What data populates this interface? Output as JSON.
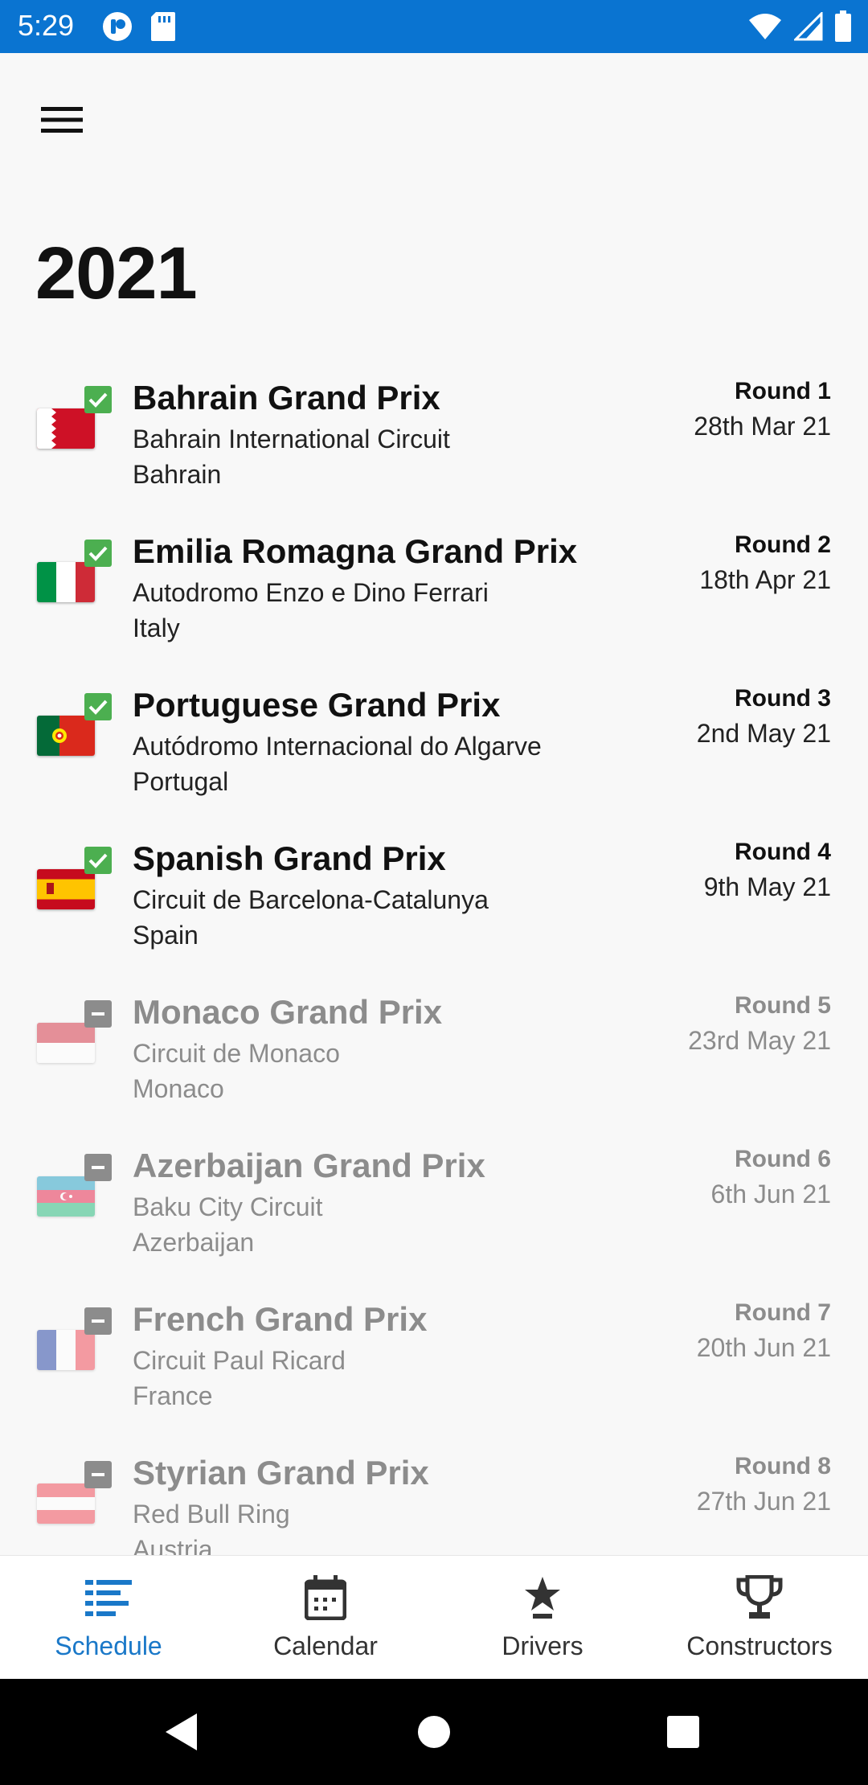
{
  "status_bar": {
    "time": "5:29",
    "icons": [
      "notification-app-icon",
      "sd-card-icon",
      "wifi-icon",
      "signal-icon",
      "battery-icon"
    ]
  },
  "header": {
    "menu_icon": "hamburger-menu-icon",
    "season": "2021"
  },
  "races": [
    {
      "name": "Bahrain Grand Prix",
      "circuit": "Bahrain International Circuit",
      "country": "Bahrain",
      "round": "Round 1",
      "date": "28th Mar 21",
      "status": "completed",
      "flag": "bahrain-flag"
    },
    {
      "name": "Emilia Romagna Grand Prix",
      "circuit": "Autodromo Enzo e Dino Ferrari",
      "country": "Italy",
      "round": "Round 2",
      "date": "18th Apr 21",
      "status": "completed",
      "flag": "italy-flag"
    },
    {
      "name": "Portuguese Grand Prix",
      "circuit": "Autódromo Internacional do Algarve",
      "country": "Portugal",
      "round": "Round 3",
      "date": "2nd May 21",
      "status": "completed",
      "flag": "portugal-flag"
    },
    {
      "name": "Spanish Grand Prix",
      "circuit": "Circuit de Barcelona-Catalunya",
      "country": "Spain",
      "round": "Round 4",
      "date": "9th May 21",
      "status": "completed",
      "flag": "spain-flag"
    },
    {
      "name": "Monaco Grand Prix",
      "circuit": "Circuit de Monaco",
      "country": "Monaco",
      "round": "Round 5",
      "date": "23rd May 21",
      "status": "upcoming",
      "flag": "monaco-flag"
    },
    {
      "name": "Azerbaijan Grand Prix",
      "circuit": "Baku City Circuit",
      "country": "Azerbaijan",
      "round": "Round 6",
      "date": "6th Jun 21",
      "status": "upcoming",
      "flag": "azerbaijan-flag"
    },
    {
      "name": "French Grand Prix",
      "circuit": "Circuit Paul Ricard",
      "country": "France",
      "round": "Round 7",
      "date": "20th Jun 21",
      "status": "upcoming",
      "flag": "france-flag"
    },
    {
      "name": "Styrian Grand Prix",
      "circuit": "Red Bull Ring",
      "country": "Austria",
      "round": "Round 8",
      "date": "27th Jun 21",
      "status": "upcoming",
      "flag": "austria-flag"
    }
  ],
  "bottom_nav": {
    "items": [
      {
        "label": "Schedule",
        "icon": "schedule-list-icon",
        "active": true
      },
      {
        "label": "Calendar",
        "icon": "calendar-icon",
        "active": false
      },
      {
        "label": "Drivers",
        "icon": "driver-star-icon",
        "active": false
      },
      {
        "label": "Constructors",
        "icon": "trophy-icon",
        "active": false
      }
    ]
  },
  "colors": {
    "status_bar": "#0a74d1",
    "accent": "#1a78c8",
    "completed_check": "#4caf50",
    "upcoming_check": "#8c8c8c"
  }
}
